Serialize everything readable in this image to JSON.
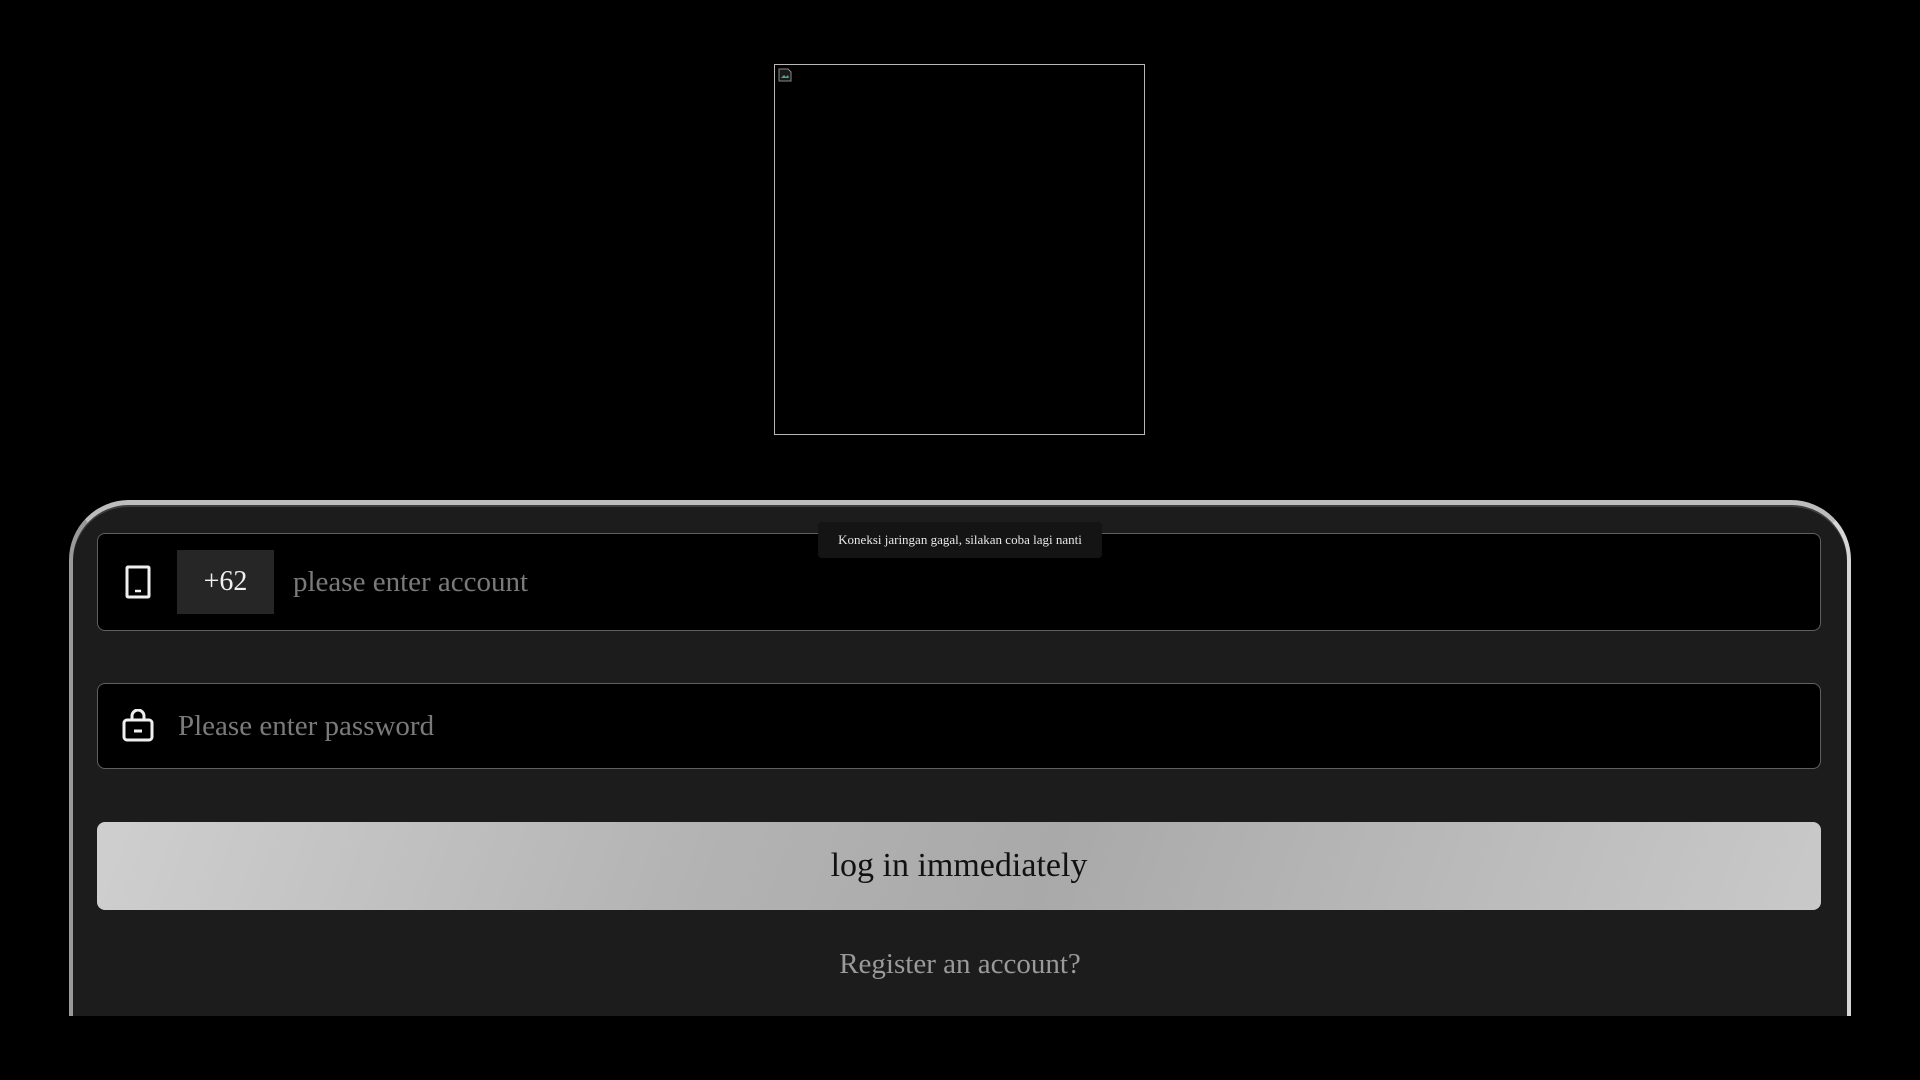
{
  "toast": {
    "message": "Koneksi jaringan gagal, silakan coba lagi nanti"
  },
  "account_field": {
    "icon": "tablet-icon",
    "country_code": "+62",
    "placeholder": "please enter account",
    "value": ""
  },
  "password_field": {
    "icon": "lock-icon",
    "placeholder": "Please enter password",
    "value": ""
  },
  "login_button": {
    "label": "log in immediately"
  },
  "register_link": {
    "label": "Register an account?"
  },
  "colors": {
    "background": "#000000",
    "card": "#1c1c1c",
    "field_border": "#5f5f5f",
    "button_gradient_start": "#cfcfcf",
    "button_gradient_end": "#a9a9a9",
    "placeholder": "#7a7a7a",
    "register_text": "#9a9a9a"
  }
}
